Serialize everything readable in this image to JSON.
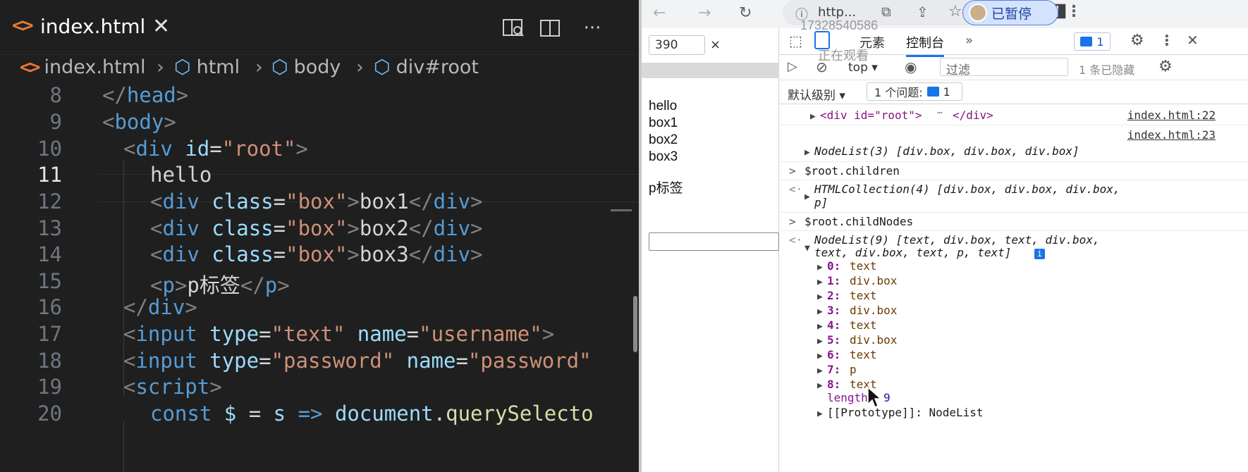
{
  "editor": {
    "tab_title": "index.html",
    "breadcrumb": [
      "index.html",
      "html",
      "body",
      "div#root"
    ],
    "lines": [
      {
        "num": "8",
        "text": "</head>"
      },
      {
        "num": "9",
        "text": "<body>"
      },
      {
        "num": "10",
        "text": "<div id=\"root\">"
      },
      {
        "num": "11",
        "text": "hello"
      },
      {
        "num": "12",
        "text": "<div class=\"box\">box1</div>"
      },
      {
        "num": "13",
        "text": "<div class=\"box\">box2</div>"
      },
      {
        "num": "14",
        "text": "<div class=\"box\">box3</div>"
      },
      {
        "num": "15",
        "text": "<p>p标签</p>"
      },
      {
        "num": "16",
        "text": "</div>"
      },
      {
        "num": "17",
        "text": "<input type=\"text\" name=\"username\">"
      },
      {
        "num": "18",
        "text": "<input type=\"password\" name=\"password\""
      },
      {
        "num": "19",
        "text": "<script>"
      },
      {
        "num": "20",
        "text": "const $ = s => document.querySelecto"
      }
    ]
  },
  "browser": {
    "url": "http...",
    "profile_status": "已暂停",
    "viewport_width": "390",
    "page_lines": [
      "hello",
      "box1",
      "box2",
      "box3",
      "p标签"
    ]
  },
  "devtools": {
    "tab_elements": "元素",
    "tab_console": "控制台",
    "issue_badge_count": "1",
    "context": "top",
    "filter_placeholder": "过滤",
    "hidden_count": "1 条已隐藏",
    "level": "默认级别",
    "issues": "1 个问题:",
    "issues_count": "1",
    "watermark_id": "17328540586",
    "watermark_status": "正在观看",
    "console": {
      "div_root": "<div id=\"root\">",
      "div_root_end": "</div>",
      "link1": "index.html:22",
      "link2": "index.html:23",
      "nodelist3": "NodeList(3) [div.box, div.box, div.box]",
      "cmd1": "$root.children",
      "htmlcollection_a": "HTMLCollection(4) [div.box, div.box, div.box,",
      "htmlcollection_b": "p]",
      "cmd2": "$root.childNodes",
      "nodelist9_a": "NodeList(9) [text, div.box, text, div.box,",
      "nodelist9_b": "text, div.box, text, p, text]",
      "entries": [
        {
          "key": "0:",
          "val": "text"
        },
        {
          "key": "1:",
          "val": "div.box"
        },
        {
          "key": "2:",
          "val": "text"
        },
        {
          "key": "3:",
          "val": "div.box"
        },
        {
          "key": "4:",
          "val": "text"
        },
        {
          "key": "5:",
          "val": "div.box"
        },
        {
          "key": "6:",
          "val": "text"
        },
        {
          "key": "7:",
          "val": "p"
        },
        {
          "key": "8:",
          "val": "text"
        }
      ],
      "length_label": "length:",
      "length_value": "9",
      "prototype": "[[Prototype]]: NodeList"
    }
  }
}
